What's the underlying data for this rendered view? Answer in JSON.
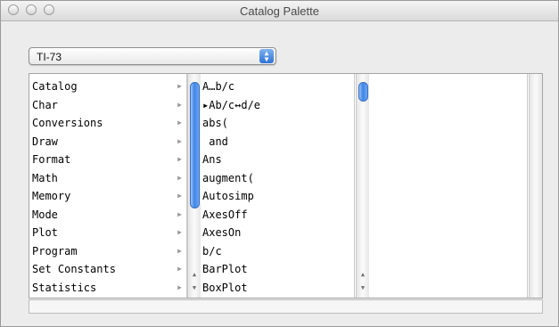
{
  "window": {
    "title": "Catalog Palette"
  },
  "model_select": {
    "value": "TI-73"
  },
  "categories": [
    {
      "label": "Catalog"
    },
    {
      "label": "Char"
    },
    {
      "label": "Conversions"
    },
    {
      "label": "Draw"
    },
    {
      "label": "Format"
    },
    {
      "label": "Math"
    },
    {
      "label": "Memory"
    },
    {
      "label": "Mode"
    },
    {
      "label": "Plot"
    },
    {
      "label": "Program"
    },
    {
      "label": "Set Constants"
    },
    {
      "label": "Statistics"
    }
  ],
  "commands": [
    {
      "label": "A…b/c"
    },
    {
      "label": "▸Ab/c↔d/e"
    },
    {
      "label": "abs("
    },
    {
      "label": " and"
    },
    {
      "label": "Ans"
    },
    {
      "label": "augment("
    },
    {
      "label": "Autosimp"
    },
    {
      "label": "AxesOff"
    },
    {
      "label": "AxesOn"
    },
    {
      "label": "b/c"
    },
    {
      "label": "BarPlot"
    },
    {
      "label": "BoxPlot"
    }
  ],
  "icons": {
    "submenu": "submenu-arrow-icon",
    "scroll_up": "scroll-up-icon",
    "scroll_down": "scroll-down-icon",
    "popup": "popup-arrows-icon"
  },
  "colors": {
    "scroll_thumb": "#3e85e6",
    "window_bg": "#ececec"
  }
}
